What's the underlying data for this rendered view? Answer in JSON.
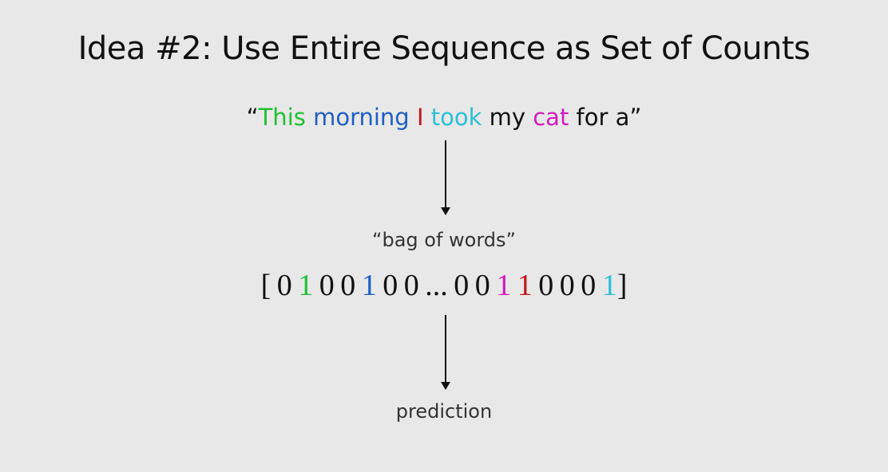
{
  "slide": {
    "title": "Idea #2: Use Entire Sequence as Set of Counts",
    "sentence": [
      {
        "text": "“",
        "color": "#111111"
      },
      {
        "text": "This",
        "color": "#22c033"
      },
      {
        "text": " ",
        "color": "#111111"
      },
      {
        "text": "morning",
        "color": "#1f5fc4"
      },
      {
        "text": " ",
        "color": "#111111"
      },
      {
        "text": "I",
        "color": "#c0161c"
      },
      {
        "text": " ",
        "color": "#111111"
      },
      {
        "text": "took",
        "color": "#2bbfd6"
      },
      {
        "text": " my ",
        "color": "#111111"
      },
      {
        "text": "cat",
        "color": "#d21bbf"
      },
      {
        "text": " for a”",
        "color": "#111111"
      }
    ],
    "bag_label": "“bag of words”",
    "vector": [
      {
        "text": "[ 0 ",
        "color": "#111111"
      },
      {
        "text": "1",
        "color": "#22c033"
      },
      {
        "text": " 0 0 ",
        "color": "#111111"
      },
      {
        "text": "1",
        "color": "#1f5fc4"
      },
      {
        "text": " 0 0 ... 0 0 ",
        "color": "#111111"
      },
      {
        "text": "1",
        "color": "#d21bbf"
      },
      {
        "text": " ",
        "color": "#111111"
      },
      {
        "text": "1",
        "color": "#c0161c"
      },
      {
        "text": " 0 0 0 ",
        "color": "#111111"
      },
      {
        "text": "1",
        "color": "#2bbfd6"
      },
      {
        "text": "]",
        "color": "#111111"
      }
    ],
    "prediction_label": "prediction"
  }
}
